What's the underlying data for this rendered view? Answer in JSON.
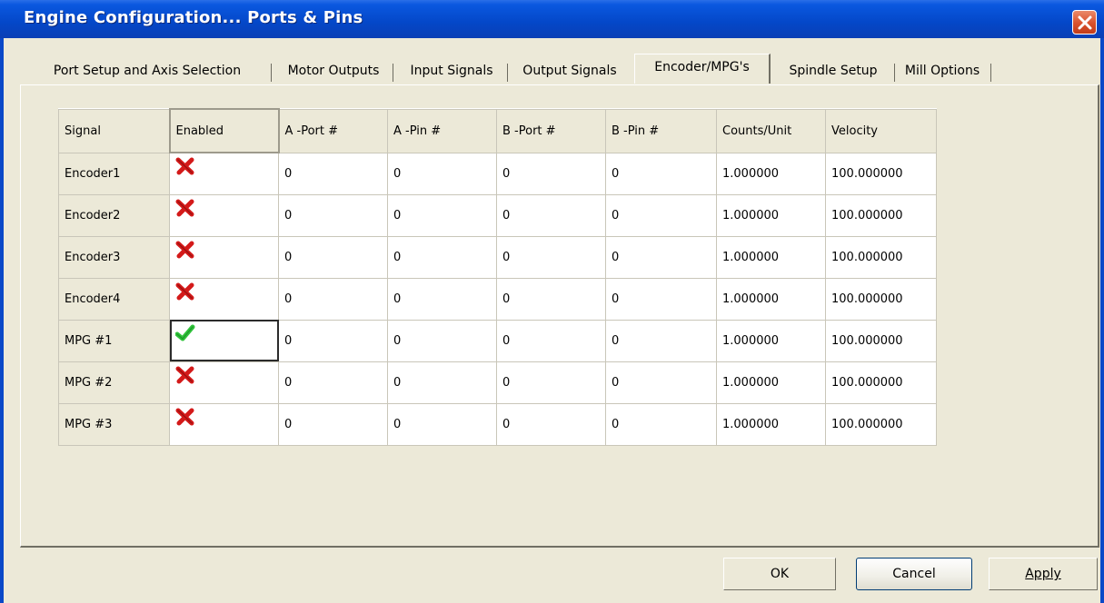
{
  "window": {
    "title": "Engine Configuration... Ports & Pins"
  },
  "tabs": [
    {
      "label": "Port Setup and Axis Selection"
    },
    {
      "label": "Motor Outputs"
    },
    {
      "label": "Input Signals"
    },
    {
      "label": "Output Signals"
    },
    {
      "label": "Encoder/MPG's",
      "active": true
    },
    {
      "label": "Spindle Setup"
    },
    {
      "label": "Mill Options"
    }
  ],
  "grid": {
    "headers": [
      "Signal",
      "Enabled",
      "A -Port #",
      "A -Pin  #",
      "B -Port #",
      "B -Pin  #",
      "Counts/Unit",
      "Velocity"
    ],
    "rows": [
      {
        "signal": "Encoder1",
        "enabled": false,
        "a_port": "0",
        "a_pin": "0",
        "b_port": "0",
        "b_pin": "0",
        "counts": "1.000000",
        "velocity": "100.000000"
      },
      {
        "signal": "Encoder2",
        "enabled": false,
        "a_port": "0",
        "a_pin": "0",
        "b_port": "0",
        "b_pin": "0",
        "counts": "1.000000",
        "velocity": "100.000000"
      },
      {
        "signal": "Encoder3",
        "enabled": false,
        "a_port": "0",
        "a_pin": "0",
        "b_port": "0",
        "b_pin": "0",
        "counts": "1.000000",
        "velocity": "100.000000"
      },
      {
        "signal": "Encoder4",
        "enabled": false,
        "a_port": "0",
        "a_pin": "0",
        "b_port": "0",
        "b_pin": "0",
        "counts": "1.000000",
        "velocity": "100.000000"
      },
      {
        "signal": "MPG #1",
        "enabled": true,
        "a_port": "0",
        "a_pin": "0",
        "b_port": "0",
        "b_pin": "0",
        "counts": "1.000000",
        "velocity": "100.000000"
      },
      {
        "signal": "MPG #2",
        "enabled": false,
        "a_port": "0",
        "a_pin": "0",
        "b_port": "0",
        "b_pin": "0",
        "counts": "1.000000",
        "velocity": "100.000000"
      },
      {
        "signal": "MPG #3",
        "enabled": false,
        "a_port": "0",
        "a_pin": "0",
        "b_port": "0",
        "b_pin": "0",
        "counts": "1.000000",
        "velocity": "100.000000"
      }
    ]
  },
  "buttons": {
    "ok": "OK",
    "cancel": "Cancel",
    "apply": "Apply"
  },
  "colors": {
    "titlebar": "#0447c8",
    "disabled_icon": "#d41a1a",
    "enabled_icon": "#2fc23a"
  },
  "icons": {
    "enabled_true": "check-icon",
    "enabled_false": "x-icon"
  }
}
